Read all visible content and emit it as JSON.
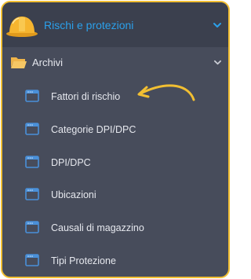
{
  "colors": {
    "border": "#f2bf32",
    "panel": "#474c5b",
    "header": "#3b404e",
    "accent": "#2ba0ea",
    "text": "#e6e8ee",
    "icon": "#4a90d9"
  },
  "header": {
    "title": "Rischi e protezioni",
    "icon": "hard-hat-icon",
    "chevron": "chevron-down-icon"
  },
  "group": {
    "label": "Archivi",
    "icon": "folder-open-icon",
    "chevron": "chevron-down-icon"
  },
  "items": [
    {
      "label": "Fattori di rischio",
      "icon": "window-icon"
    },
    {
      "label": "Categorie DPI/DPC",
      "icon": "window-icon"
    },
    {
      "label": "DPI/DPC",
      "icon": "window-icon"
    },
    {
      "label": "Ubicazioni",
      "icon": "window-icon"
    },
    {
      "label": "Causali di magazzino",
      "icon": "window-icon"
    },
    {
      "label": "Tipi Protezione",
      "icon": "window-icon"
    }
  ],
  "annotation": {
    "icon": "curved-arrow-icon",
    "points_to": "Fattori di rischio"
  }
}
